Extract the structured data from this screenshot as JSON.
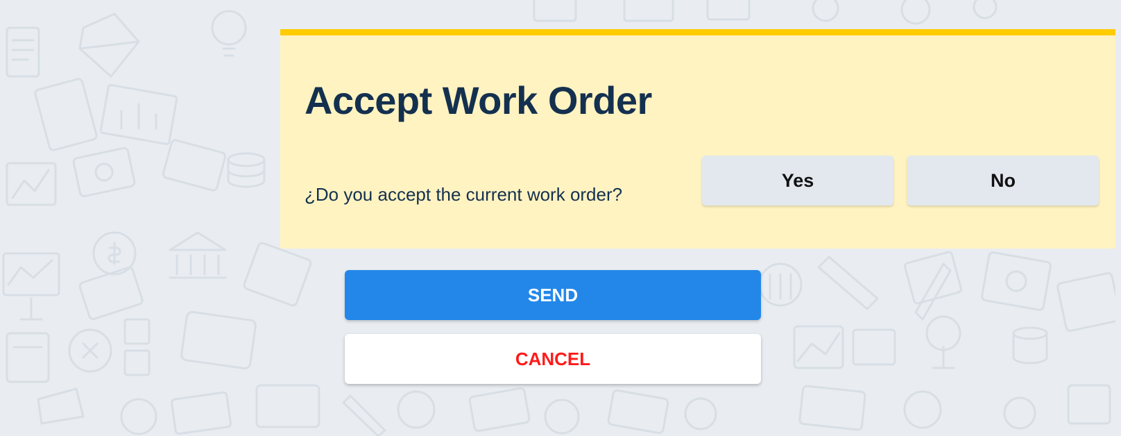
{
  "colors": {
    "background": "#e9edf1",
    "card_background": "#fff3c1",
    "card_accent": "#ffcc00",
    "title_text": "#14304f",
    "send_button": "#2387ea",
    "cancel_text": "#ff1a1a",
    "choice_button": "#e3e8ee"
  },
  "card": {
    "title": "Accept Work Order",
    "question": "¿Do you accept the current work order?",
    "yes_label": "Yes",
    "no_label": "No"
  },
  "actions": {
    "send_label": "SEND",
    "cancel_label": "CANCEL"
  },
  "background_icons": [
    "document-icon",
    "lightbulb-icon",
    "diamond-icon",
    "chart-icon",
    "coin-stack-icon",
    "bank-icon",
    "dollar-icon",
    "pencil-icon",
    "calculator-icon",
    "wallet-icon"
  ]
}
